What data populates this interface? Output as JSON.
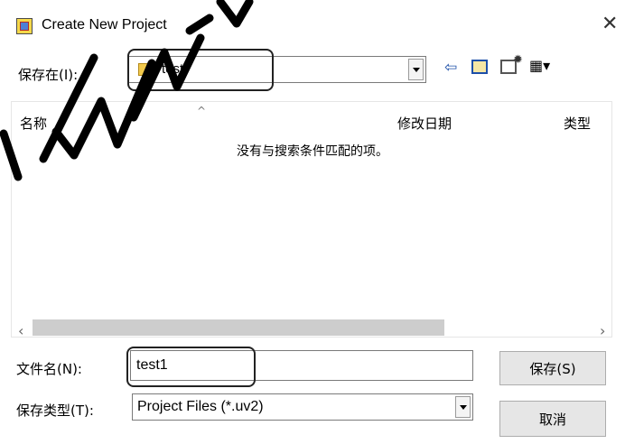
{
  "window": {
    "title": "Create New Project",
    "close_glyph": "✕"
  },
  "save_in": {
    "label": "保存在(I):",
    "value": "test",
    "icon": "folder-icon"
  },
  "toolbar": {
    "back_glyph": "⇦",
    "up_glyph": "⎗",
    "new_folder_glyph": "✹",
    "view_glyph": "▦▾"
  },
  "columns": {
    "name": "名称",
    "date_modified": "修改日期",
    "type": "类型"
  },
  "list": {
    "empty_message": "没有与搜索条件匹配的项。"
  },
  "file_name": {
    "label": "文件名(N):",
    "value": "test1"
  },
  "file_type": {
    "label": "保存类型(T):",
    "value": "Project Files (*.uv2)"
  },
  "buttons": {
    "save": "保存(S)",
    "cancel": "取消"
  },
  "scroll": {
    "left_glyph": "‹",
    "right_glyph": "›"
  }
}
